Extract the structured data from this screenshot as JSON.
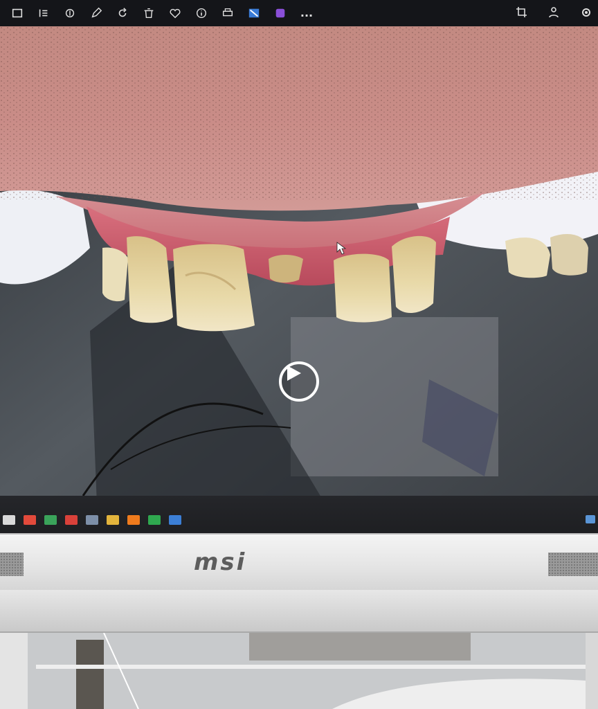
{
  "toolbar": {
    "left_buttons": [
      {
        "icon": "zoom-fit-icon"
      },
      {
        "icon": "rotate-left-icon"
      },
      {
        "icon": "fingerprint-icon"
      },
      {
        "icon": "edit-icon"
      },
      {
        "icon": "rotate-icon"
      },
      {
        "icon": "trash-icon"
      },
      {
        "icon": "heart-icon"
      },
      {
        "icon": "info-icon"
      },
      {
        "icon": "print-icon"
      },
      {
        "icon": "share-icon"
      },
      {
        "icon": "app-icon"
      },
      {
        "icon": "more-icon"
      }
    ],
    "more_label": "...",
    "right_buttons": [
      {
        "icon": "crop-icon"
      },
      {
        "icon": "people-icon"
      },
      {
        "icon": "settings-icon"
      }
    ]
  },
  "media": {
    "play_icon": "play-icon"
  },
  "taskbar": {
    "icons": [
      "cp-icon",
      "bars-icon",
      "green-app-icon",
      "red-app-icon",
      "monitor-icon",
      "folder-icon",
      "vlc-icon",
      "green-meet-icon",
      "blue-app-icon"
    ],
    "colors": [
      "#d8d8d8",
      "#e24a3b",
      "#3aa35a",
      "#d9413a",
      "#7d8fa8",
      "#e3b43c",
      "#ef7b1d",
      "#2fa84f",
      "#3c7fd6"
    ]
  },
  "monitor": {
    "brand": "msi"
  }
}
